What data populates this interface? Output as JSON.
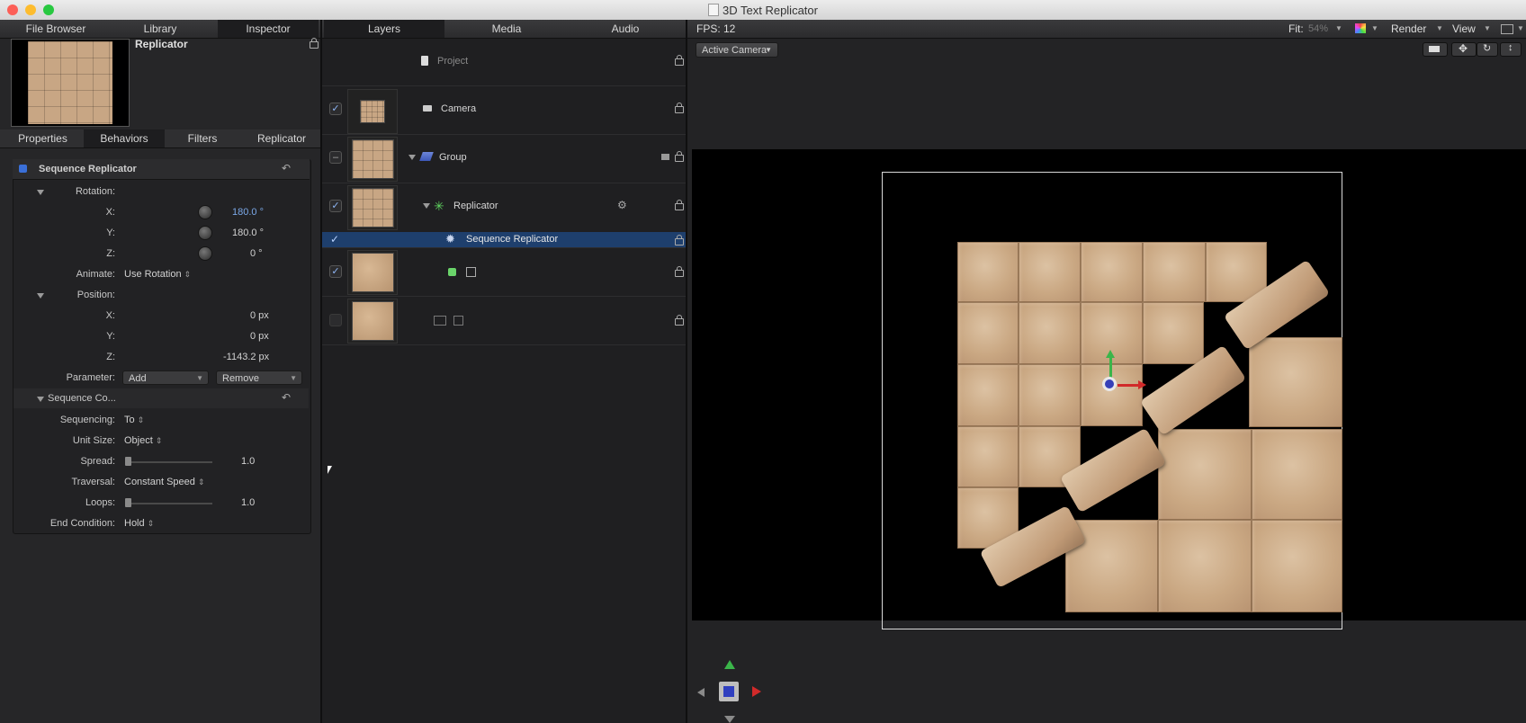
{
  "window": {
    "title": "3D Text Replicator"
  },
  "left_tabs": [
    "File Browser",
    "Library",
    "Inspector"
  ],
  "inspector": {
    "preview_title": "Replicator",
    "subtabs": [
      "Properties",
      "Behaviors",
      "Filters",
      "Replicator"
    ],
    "behavior_title": "Sequence Replicator",
    "rotation": {
      "label": "Rotation:",
      "x_label": "X:",
      "x": "180.0 °",
      "y_label": "Y:",
      "y": "180.0 °",
      "z_label": "Z:",
      "z": "0 °"
    },
    "animate": {
      "label": "Animate:",
      "value": "Use Rotation"
    },
    "position": {
      "label": "Position:",
      "x_label": "X:",
      "x": "0 px",
      "y_label": "Y:",
      "y": "0 px",
      "z_label": "Z:",
      "z": "-1143.2 px"
    },
    "parameter": {
      "label": "Parameter:",
      "add": "Add",
      "remove": "Remove"
    },
    "sequence_controls": {
      "title": "Sequence Co...",
      "sequencing_label": "Sequencing:",
      "sequencing": "To",
      "unit_size_label": "Unit Size:",
      "unit_size": "Object",
      "spread_label": "Spread:",
      "spread": "1.0",
      "traversal_label": "Traversal:",
      "traversal": "Constant Speed",
      "loops_label": "Loops:",
      "loops": "1.0",
      "end_condition_label": "End Condition:",
      "end_condition": "Hold"
    }
  },
  "middle_tabs": [
    "Layers",
    "Media",
    "Audio"
  ],
  "layers": {
    "project": "Project",
    "camera": "Camera",
    "group": "Group",
    "replicator": "Replicator",
    "sequence_replicator": "Sequence Replicator"
  },
  "canvas": {
    "fps": "FPS: 12",
    "fit_label": "Fit:",
    "fit_value": "54%",
    "render": "Render",
    "view": "View",
    "camera_menu": "Active Camera"
  },
  "colors": {
    "accent": "#3a6fd8",
    "selection": "#1e3f6d",
    "tile": "#caa883"
  }
}
